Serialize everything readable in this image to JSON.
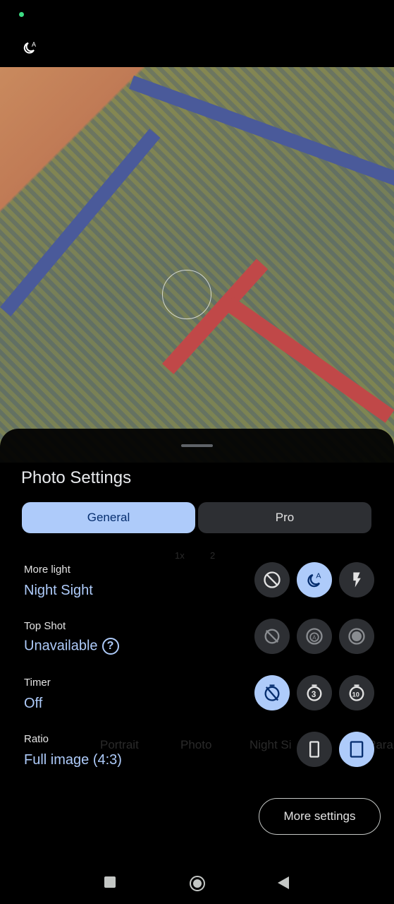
{
  "status": {
    "top_icon": "night-sight-auto-icon"
  },
  "sheet": {
    "title": "Photo Settings",
    "tabs": [
      {
        "label": "General",
        "selected": true
      },
      {
        "label": "Pro",
        "selected": false
      }
    ],
    "settings": [
      {
        "label": "More light",
        "value": "Night Sight",
        "options": [
          "off-icon",
          "night-sight-auto-icon",
          "flash-icon"
        ],
        "selected": 1
      },
      {
        "label": "Top Shot",
        "value": "Unavailable",
        "help_icon": "?",
        "options": [
          "top-shot-off-icon",
          "top-shot-auto-icon",
          "top-shot-on-icon"
        ],
        "selected": null
      },
      {
        "label": "Timer",
        "value": "Off",
        "options": [
          "timer-off-icon",
          "timer-3-icon",
          "timer-10-icon"
        ],
        "selected": 0
      },
      {
        "label": "Ratio",
        "value": "Full image (4:3)",
        "options": [
          "ratio-9-16-icon",
          "ratio-3-4-icon"
        ],
        "selected": 1
      }
    ],
    "more_settings": "More settings"
  },
  "background": {
    "zoom": [
      "1x",
      "2"
    ],
    "modes": [
      "Portrait",
      "Photo",
      "Night Si",
      "Paran"
    ]
  },
  "colors": {
    "accent": "#aecbfa",
    "chip": "#2d2f33"
  }
}
